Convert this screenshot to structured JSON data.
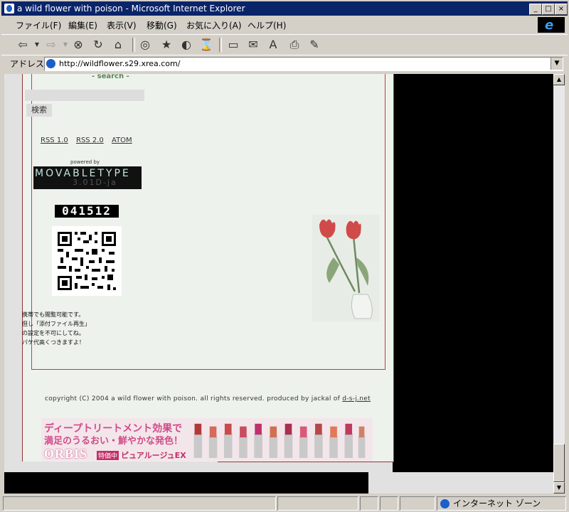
{
  "window": {
    "title": "a wild flower with poison - Microsoft Internet Explorer"
  },
  "menu": {
    "items": [
      "ファイル(F)",
      "編集(E)",
      "表示(V)",
      "移動(G)",
      "お気に入り(A)",
      "ヘルプ(H)"
    ]
  },
  "address": {
    "label": "アドレス",
    "url": "http://wildflower.s29.xrea.com/"
  },
  "page": {
    "search_title": "- search -",
    "search_button": "検索",
    "feeds": [
      "RSS 1.0",
      "RSS 2.0",
      "ATOM"
    ],
    "powered_by": "powered by",
    "mt_logo_main": "MOVABLETYPE",
    "mt_logo_version": "3.01D-ja",
    "counter": "041512",
    "mobile_lines": [
      "携帯でも閲覧可能です。",
      "但し「添付ファイル再生」",
      "の設定を不可にしてね。",
      "パケ代高くつきますよ！"
    ],
    "copyright": "copyright (C) 2004 a wild flower with poison. all rights reserved. produced by jackal of",
    "copyright_link": "d-s-j.net"
  },
  "banner": {
    "line1": "ディープトリートメント効果で",
    "line2": "満足のうるおい・鮮やかな発色！",
    "brand": "ORBIS",
    "badge": "特価中",
    "product": "ピュアルージュEX"
  },
  "status": {
    "zone": "インターネット ゾーン"
  }
}
